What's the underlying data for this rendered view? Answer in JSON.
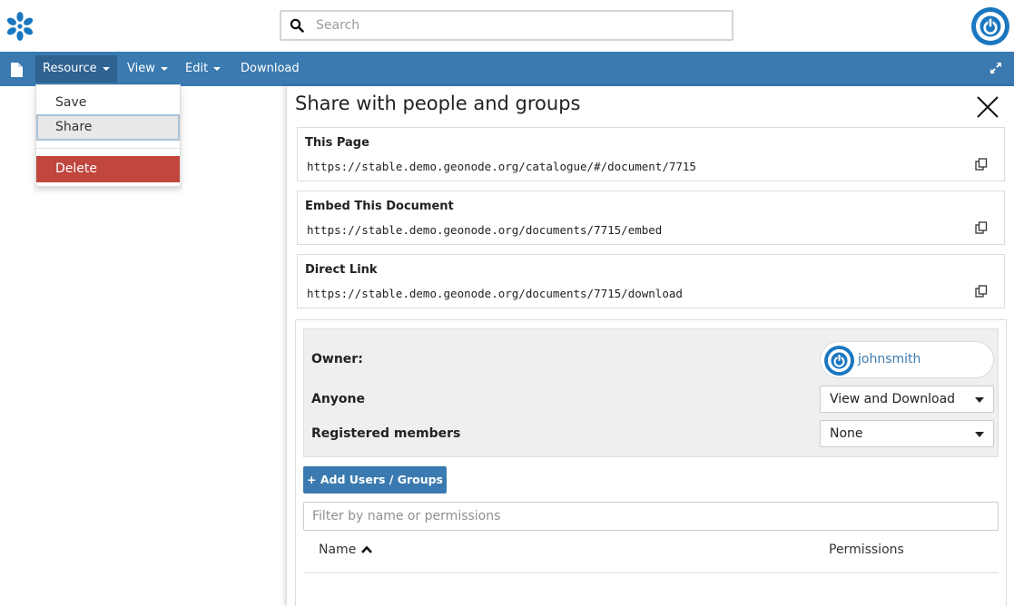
{
  "header": {
    "logo": "geonode-flower-logo",
    "search": {
      "placeholder": "Search",
      "value": ""
    },
    "user_avatar": "power-icon",
    "accent_color": "#1a77c0"
  },
  "toolbar": {
    "background": "#3a7ab0",
    "file_icon": "file-icon",
    "menus": [
      {
        "label": "Resource",
        "active": true
      },
      {
        "label": "View"
      },
      {
        "label": "Edit"
      },
      {
        "label": "Download"
      }
    ],
    "expand_icon": "expand-icon"
  },
  "resource_menu": {
    "items": [
      {
        "label": "Save"
      },
      {
        "label": "Share",
        "selected": true
      },
      {
        "label": "Delete",
        "danger": true
      }
    ]
  },
  "share_panel": {
    "title": "Share with people and groups",
    "close_icon": "close-icon",
    "links": [
      {
        "label": "This Page",
        "url": "https://stable.demo.geonode.org/catalogue/#/document/7715"
      },
      {
        "label": "Embed This Document",
        "url": "https://stable.demo.geonode.org/documents/7715/embed"
      },
      {
        "label": "Direct Link",
        "url": "https://stable.demo.geonode.org/documents/7715/download"
      }
    ],
    "permissions": {
      "owner_label": "Owner:",
      "owner_name": "johnsmith",
      "anyone_label": "Anyone",
      "anyone_value": "View and Download",
      "registered_label": "Registered members",
      "registered_value": "None"
    },
    "add_button_label": "+ Add Users / Groups",
    "filter_placeholder": "Filter by name or permissions",
    "table": {
      "col_name": "Name",
      "col_permissions": "Permissions",
      "sort": "ascending"
    }
  }
}
